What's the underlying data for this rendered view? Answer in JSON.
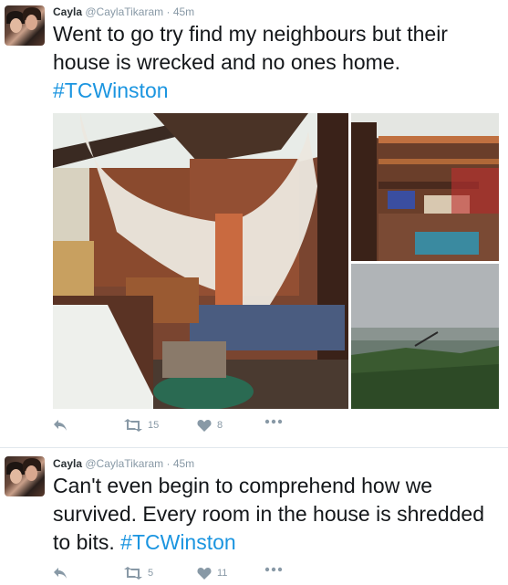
{
  "tweets": [
    {
      "name": "Cayla",
      "handle": "@CaylaTikaram",
      "time": "45m",
      "text": "Went to go try find my neighbours but their house is wrecked and no ones home. ",
      "hashtag": "#TCWinston",
      "actions": {
        "retweets": "15",
        "likes": "8"
      },
      "photos": [
        "photo-interior-destroyed-room",
        "photo-collapsed-shelves",
        "photo-stormy-landscape"
      ]
    },
    {
      "name": "Cayla",
      "handle": "@CaylaTikaram",
      "time": "45m",
      "text": "Can't even begin to comprehend how we survived. Every room in the house is shredded to bits. ",
      "hashtag": "#TCWinston",
      "actions": {
        "retweets": "5",
        "likes": "11"
      }
    }
  ],
  "icons": {
    "reply": "reply-icon",
    "retweet": "retweet-icon",
    "like": "heart-icon",
    "more": "more-icon"
  },
  "colors": {
    "hashtag": "#1b95e0",
    "meta": "#8899a6",
    "text": "#14171a"
  }
}
